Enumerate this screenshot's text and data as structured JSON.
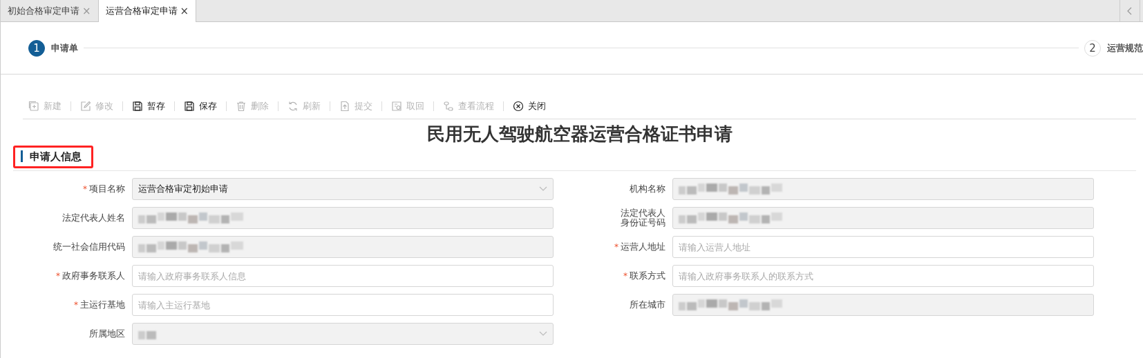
{
  "tabs": [
    {
      "label": "初始合格审定申请",
      "selected": false,
      "close": "×"
    },
    {
      "label": "运营合格审定申请",
      "selected": true,
      "close": "×"
    }
  ],
  "steps": [
    {
      "number": "1",
      "label": "申请单",
      "selected": true
    },
    {
      "number": "2",
      "label": "运营规范",
      "selected": false
    }
  ],
  "toolbar": [
    {
      "kind": "new",
      "label": "新建",
      "disabled": true
    },
    {
      "kind": "edit",
      "label": "修改",
      "disabled": true
    },
    {
      "kind": "save",
      "label": "暂存",
      "disabled": false
    },
    {
      "kind": "save",
      "label": "保存",
      "disabled": false
    },
    {
      "kind": "delete",
      "label": "删除",
      "disabled": true
    },
    {
      "kind": "refresh",
      "label": "刷新",
      "disabled": true
    },
    {
      "kind": "submit",
      "label": "提交",
      "disabled": true
    },
    {
      "kind": "retrieve",
      "label": "取回",
      "disabled": true
    },
    {
      "kind": "flow",
      "label": "查看流程",
      "disabled": true
    },
    {
      "kind": "close",
      "label": "关闭",
      "disabled": false
    }
  ],
  "form_title": "民用无人驾驶航空器运营合格证书申请",
  "section": {
    "title": "申请人信息",
    "highlighted": true
  },
  "fields": [
    {
      "label": "项目名称",
      "required_mark": "*",
      "kind": "select",
      "value": "运营合格审定初始申请"
    },
    {
      "label": "机构名称",
      "kind": "readonly",
      "redacted": true
    },
    {
      "label": "法定代表人姓名",
      "kind": "readonly",
      "redacted": true
    },
    {
      "label_lines": [
        "法定代表人",
        "身份证号码"
      ],
      "kind": "readonly",
      "redacted": true
    },
    {
      "label": "统一社会信用代码",
      "kind": "readonly",
      "redacted": true
    },
    {
      "label": "运营人地址",
      "required_mark": "*",
      "kind": "input",
      "placeholder": "请输入运营人地址"
    },
    {
      "label": "政府事务联系人",
      "required_mark": "*",
      "kind": "input",
      "placeholder": "请输入政府事务联系人信息"
    },
    {
      "label": "联系方式",
      "required_mark": "*",
      "kind": "input",
      "placeholder": "请输入政府事务联系人的联系方式"
    },
    {
      "label": "主运行基地",
      "required_mark": "*",
      "kind": "input",
      "placeholder": "请输入主运行基地"
    },
    {
      "label": "所在城市",
      "kind": "readonly",
      "redacted": true
    },
    {
      "label": "所属地区",
      "kind": "select",
      "redacted": true
    }
  ]
}
